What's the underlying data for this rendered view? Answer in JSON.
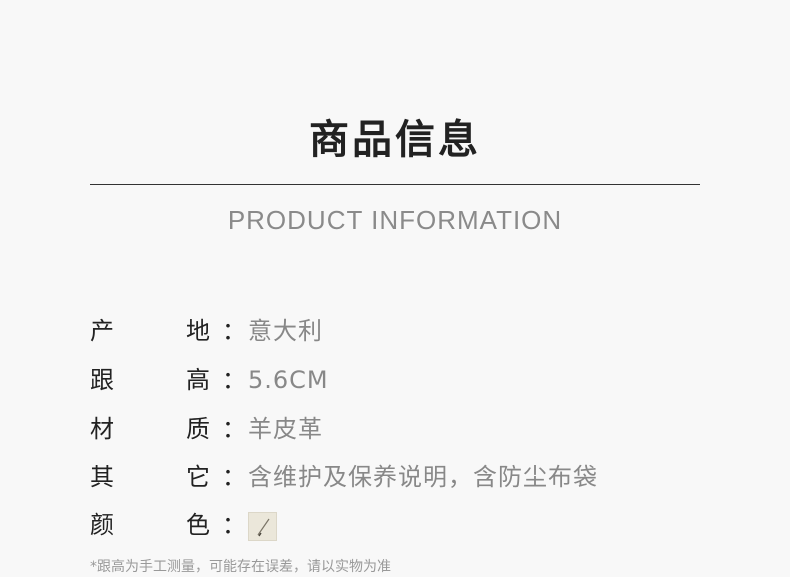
{
  "header": {
    "title": "商品信息",
    "subtitle": "PRODUCT INFORMATION"
  },
  "specs": [
    {
      "key1": "产",
      "key2": "地",
      "colon": "：",
      "value": "意大利"
    },
    {
      "key1": "跟",
      "key2": "高",
      "colon": "：",
      "value": "5.6CM"
    },
    {
      "key1": "材",
      "key2": "质",
      "colon": "：",
      "value": "羊皮革"
    },
    {
      "key1": "其",
      "key2": "它",
      "colon": "：",
      "value": "含维护及保养说明，含防尘布袋"
    },
    {
      "key1": "颜",
      "key2": "色",
      "colon": "：",
      "swatch_color": "#ebe7da"
    }
  ],
  "note": "*跟高为手工测量，可能存在误差，请以实物为准"
}
